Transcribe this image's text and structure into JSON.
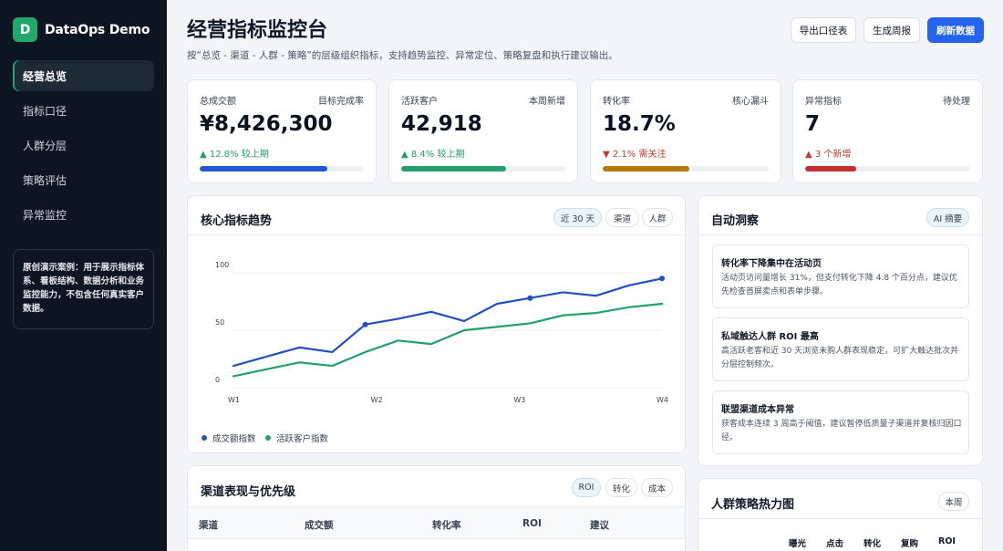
{
  "brand": {
    "logo_letter": "D",
    "name": "DataOps Demo"
  },
  "sidebar": {
    "items": [
      {
        "label": "经营总览"
      },
      {
        "label": "指标口径"
      },
      {
        "label": "人群分层"
      },
      {
        "label": "策略评估"
      },
      {
        "label": "异常监控"
      }
    ],
    "note": "原创演示案例：用于展示指标体系、看板结构、数据分析和业务监控能力，不包含任何真实客户数据。"
  },
  "header": {
    "title": "经营指标监控台",
    "subtitle": "按“总览 - 渠道 - 人群 - 策略”的层级组织指标，支持趋势监控、异常定位、策略复盘和执行建议输出。",
    "buttons": {
      "export": "导出口径表",
      "report": "生成周报",
      "refresh": "刷新数据"
    }
  },
  "kpis": [
    {
      "label": "总成交额",
      "right": "目标完成率",
      "value": "¥8,426,300",
      "delta": "▲ 12.8% 较上期",
      "delta_color": "#1f9d6b",
      "progress": 0.78,
      "bar_color": "#2158d4"
    },
    {
      "label": "活跃客户",
      "right": "本周新增",
      "value": "42,918",
      "delta": "▲ 8.4% 较上期",
      "delta_color": "#1f9d6b",
      "progress": 0.64,
      "bar_color": "#23a06b"
    },
    {
      "label": "转化率",
      "right": "核心漏斗",
      "value": "18.7%",
      "delta": "▼ 2.1% 需关注",
      "delta_color": "#c0392b",
      "progress": 0.52,
      "bar_color": "#b7790f"
    },
    {
      "label": "异常指标",
      "right": "待处理",
      "value": "7",
      "delta": "▲ 3 个新增",
      "delta_color": "#c0392b",
      "progress": 0.31,
      "bar_color": "#c53030"
    }
  ],
  "trend": {
    "title": "核心指标趋势",
    "chips": [
      "近 30 天",
      "渠道",
      "人群"
    ]
  },
  "chart_data": {
    "type": "line",
    "x": [
      1,
      2,
      3,
      4,
      5,
      6,
      7,
      8,
      9,
      10,
      11,
      12,
      13,
      14,
      15,
      16
    ],
    "xticks": [
      "W1",
      "W2",
      "W3",
      "W4"
    ],
    "xtick_positions": [
      1,
      6,
      11,
      16
    ],
    "ylim": [
      0,
      100
    ],
    "yticks": [
      0,
      50,
      100
    ],
    "grid": true,
    "legend": "bottom-left",
    "series": [
      {
        "name": "成交额指数",
        "color": "#2150c2",
        "values": [
          19,
          27,
          35,
          31,
          55,
          60,
          66,
          58,
          73,
          78,
          83,
          80,
          89,
          95
        ],
        "markers": [
          4,
          9,
          13
        ]
      },
      {
        "name": "活跃客户指数",
        "color": "#23a06b",
        "values": [
          10,
          16,
          22,
          19,
          31,
          41,
          38,
          50,
          53,
          56,
          63,
          65,
          70,
          73
        ],
        "markers": []
      }
    ]
  },
  "insights": {
    "title": "自动洞察",
    "chip": "AI 摘要",
    "items": [
      {
        "title": "转化率下降集中在活动页",
        "body": "活动页访问量增长 31%，但支付转化下降 4.8 个百分点，建议优先检查首屏卖点和表单步骤。"
      },
      {
        "title": "私域触达人群 ROI 最高",
        "body": "高活跃老客和近 30 天浏览未购人群表现稳定，可扩大触达批次并分层控制频次。"
      },
      {
        "title": "联盟渠道成本异常",
        "body": "获客成本连续 3 周高于阈值，建议暂停低质量子渠道并复核归因口径。"
      }
    ]
  },
  "channels": {
    "title": "渠道表现与优先级",
    "chips": [
      "ROI",
      "转化",
      "成本"
    ],
    "columns": [
      "渠道",
      "成交额",
      "转化率",
      "ROI",
      "建议"
    ]
  },
  "heatmap": {
    "title": "人群策略热力图",
    "chip": "本周",
    "columns": [
      "曝光",
      "点击",
      "转化",
      "复购",
      "ROI"
    ],
    "first_row_colors": [
      "#23a06b",
      "#23a06b",
      "#23a06b",
      "#2150c2",
      "#23a06b"
    ]
  }
}
